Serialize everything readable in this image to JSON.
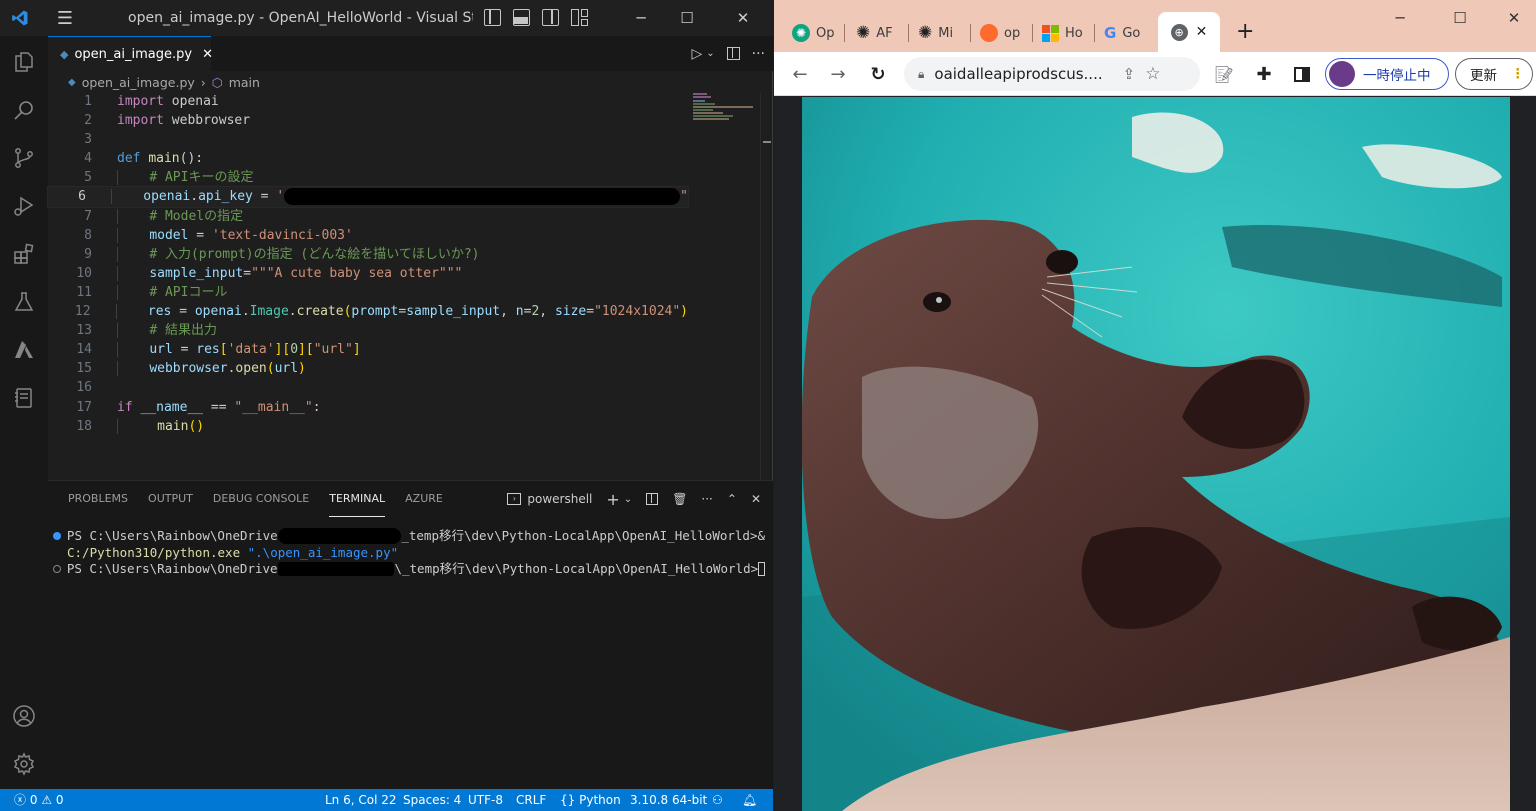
{
  "vscode": {
    "title": "open_ai_image.py - OpenAI_HelloWorld - Visual Stu...",
    "tab": {
      "name": "open_ai_image.py"
    },
    "breadcrumb": {
      "file": "open_ai_image.py",
      "symbol": "main"
    },
    "code": {
      "l1": [
        "import",
        " openai"
      ],
      "l2": [
        "import",
        " webbrowser"
      ],
      "l4": [
        "def",
        " ",
        "main",
        "():"
      ],
      "l5": "# APIキーの設定",
      "l6": [
        "openai",
        ".",
        "api_key",
        " = ",
        "'",
        "\""
      ],
      "l7": "# Modelの指定",
      "l8": [
        "model",
        " = ",
        "'text-davinci-003'"
      ],
      "l9": "# 入力(prompt)の指定 (どんな絵を描いてほしいか?)",
      "l10": [
        "sample_input",
        "=",
        "\"\"\"A cute baby sea otter\"\"\""
      ],
      "l11": "# APIコール",
      "l12": [
        "res",
        " = ",
        "openai",
        ".",
        "Image",
        ".",
        "create",
        "(",
        "prompt",
        "=",
        "sample_input",
        ", ",
        "n",
        "=",
        "2",
        ", ",
        "size",
        "=",
        "\"1024x1024\"",
        ")"
      ],
      "l13": "# 結果出力",
      "l14": [
        "url",
        " = ",
        "res",
        "[",
        "'data'",
        "][",
        "0",
        "][",
        "\"url\"",
        "]"
      ],
      "l15": [
        "webbrowser",
        ".",
        "open",
        "(",
        "url",
        ")"
      ],
      "l17": [
        "if",
        " ",
        "__name__",
        " == ",
        "\"__main__\"",
        ":"
      ],
      "l18": [
        "main",
        "()"
      ]
    },
    "line_numbers": [
      "1",
      "2",
      "3",
      "4",
      "5",
      "6",
      "7",
      "8",
      "9",
      "10",
      "11",
      "12",
      "13",
      "14",
      "15",
      "16",
      "17",
      "18"
    ],
    "panel": {
      "tabs": [
        "PROBLEMS",
        "OUTPUT",
        "DEBUG CONSOLE",
        "TERMINAL",
        "AZURE"
      ],
      "shell": "powershell",
      "terminal": {
        "line1a": "PS C:\\Users\\Rainbow\\OneDrive",
        "line1b": "_temp移行\\dev\\Python-LocalApp\\OpenAI_HelloWorld>&",
        "line2a": "C:/Python310/python.exe",
        "line2b": " \".\\open_ai_image.py\"",
        "line3a": "PS C:\\Users\\Rainbow\\OneDrive",
        "line3b": "\\_temp移行\\dev\\Python-LocalApp\\OpenAI_HelloWorld>"
      }
    },
    "status": {
      "problems": "0",
      "warnings": "0",
      "position": "Ln 6, Col 22",
      "spaces": "Spaces: 4",
      "encoding": "UTF-8",
      "eol": "CRLF",
      "language": "Python",
      "interpreter": "3.10.8 64-bit"
    },
    "accent": "#0078d4"
  },
  "chrome": {
    "tabs": [
      {
        "label": "Op",
        "icon": "openai-icon"
      },
      {
        "label": "AF",
        "icon": "openai-icon"
      },
      {
        "label": "Mi",
        "icon": "openai-icon"
      },
      {
        "label": "op",
        "icon": "orange-circle-icon"
      },
      {
        "label": "Ho",
        "icon": "microsoft-icon"
      },
      {
        "label": "Go",
        "icon": "google-icon"
      }
    ],
    "active_tab_icon": "globe-icon",
    "url": "oaidalleapiprodscus....",
    "pause_label": "一時停止中",
    "update_label": "更新",
    "frame_color": "#f0c8b7"
  }
}
